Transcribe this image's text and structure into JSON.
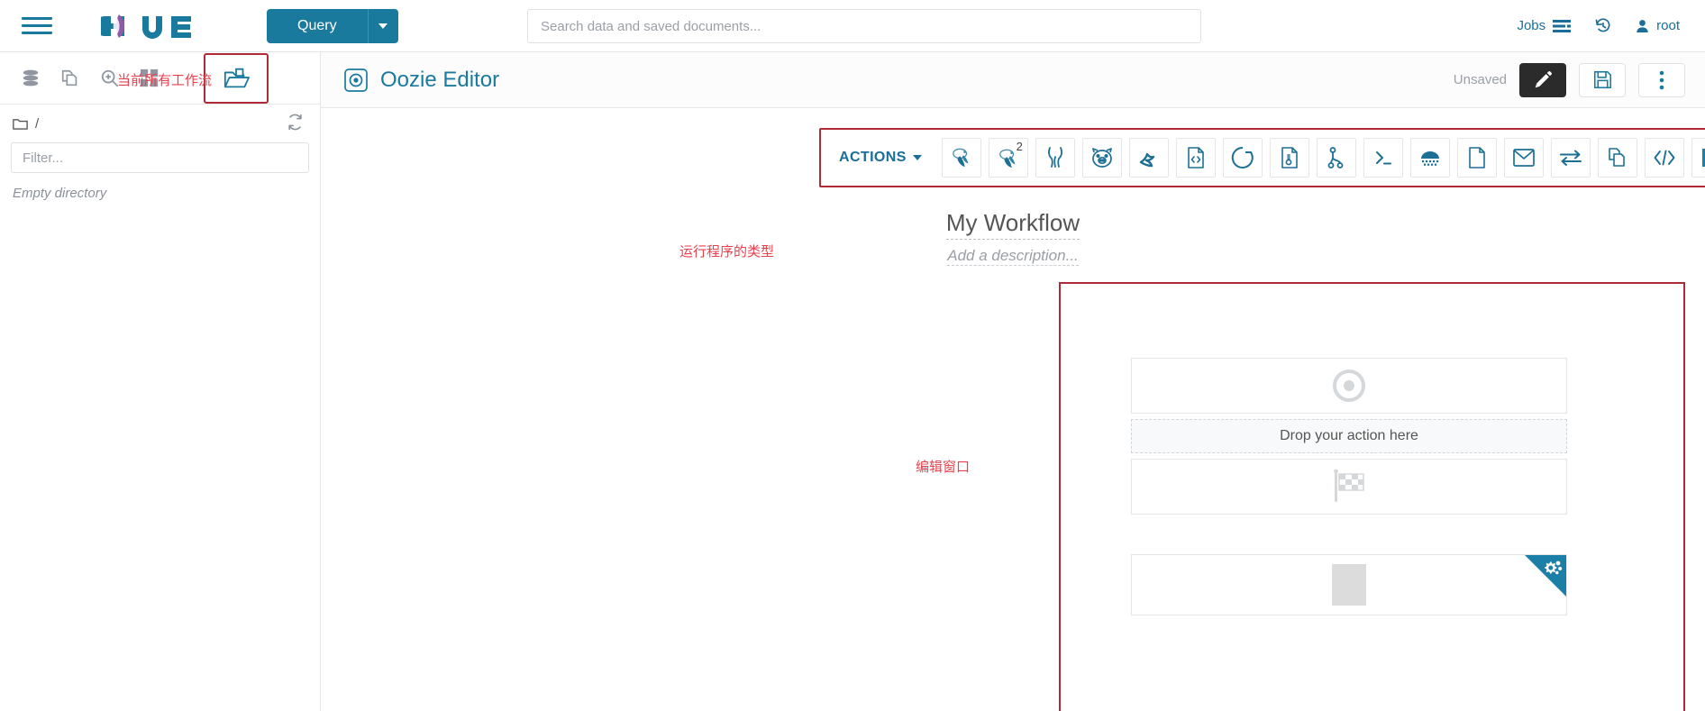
{
  "topnav": {
    "hamburger_name": "menu",
    "logo_text": "hue",
    "query_button": "Query",
    "search": {
      "placeholder": "Search data and saved documents...",
      "value": ""
    },
    "jobs_label": "Jobs",
    "history_label": "",
    "user_label": "root"
  },
  "leftpanel": {
    "icons": [
      {
        "name": "database-icon",
        "label": "Databases"
      },
      {
        "name": "documents-icon",
        "label": "Documents"
      },
      {
        "name": "search-plus-icon",
        "label": "Search"
      },
      {
        "name": "grid-icon",
        "label": "Apps"
      }
    ],
    "annotation": "当前所有工作流",
    "active_icon": {
      "name": "open-folder-icon",
      "label": "Files"
    },
    "path": "/",
    "filter": {
      "placeholder": "Filter...",
      "value": ""
    },
    "empty_text": "Empty directory",
    "refresh_label": "Refresh"
  },
  "editor": {
    "title": "Oozie Editor",
    "status": "Unsaved",
    "edit_button_label": "Edit",
    "save_button_label": "Save",
    "more_button_label": "More options"
  },
  "actions": {
    "annotation": "运行程序的类型",
    "label": "ACTIONS",
    "items": [
      {
        "name": "hive-icon",
        "label": "Hive",
        "sup": ""
      },
      {
        "name": "hive2-icon",
        "label": "Hive Server 2",
        "sup": "2"
      },
      {
        "name": "impala-icon",
        "label": "Impala",
        "sup": ""
      },
      {
        "name": "pig-icon",
        "label": "Pig",
        "sup": ""
      },
      {
        "name": "spark-icon",
        "label": "Spark",
        "sup": ""
      },
      {
        "name": "java-xml-icon",
        "label": "Java",
        "sup": ""
      },
      {
        "name": "sqoop-circle-icon",
        "label": "Sqoop",
        "sup": ""
      },
      {
        "name": "distcp-file-icon",
        "label": "DistCp",
        "sup": ""
      },
      {
        "name": "fork-icon",
        "label": "Fork",
        "sup": ""
      },
      {
        "name": "shell-icon",
        "label": "Shell",
        "sup": ""
      },
      {
        "name": "mapreduce-icon",
        "label": "MapReduce",
        "sup": ""
      },
      {
        "name": "file-icon",
        "label": "Fs",
        "sup": ""
      },
      {
        "name": "email-icon",
        "label": "Email",
        "sup": ""
      },
      {
        "name": "transfer-icon",
        "label": "Streaming",
        "sup": ""
      },
      {
        "name": "copy-docs-icon",
        "label": "Sub-workflow",
        "sup": ""
      },
      {
        "name": "code-icon",
        "label": "Generic",
        "sup": ""
      },
      {
        "name": "stop-square-icon",
        "label": "Kill",
        "sup": ""
      }
    ]
  },
  "workflow": {
    "title": "My Workflow",
    "description": "Add a description...",
    "canvas_annotation": "编辑窗口",
    "start_node": {
      "name": "start-node",
      "icon": "start-circle-icon"
    },
    "drop_zone_text": "Drop your action here",
    "end_node": {
      "name": "end-node",
      "icon": "checkered-flag-icon"
    },
    "kill_node": {
      "name": "kill-node",
      "icon": "stop-square-icon",
      "settings_icon": "gears-icon"
    }
  },
  "colors": {
    "brand_blue": "#1a7a9e",
    "annotation_red": "#e8414d",
    "highlight_border": "#b02a37",
    "text_gray": "#555555"
  }
}
